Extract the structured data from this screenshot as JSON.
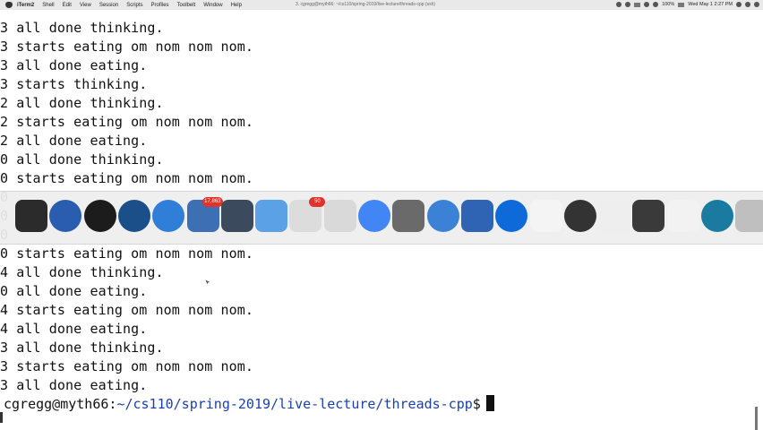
{
  "menubar": {
    "app_name": "iTerm2",
    "items": [
      "Shell",
      "Edit",
      "View",
      "Session",
      "Scripts",
      "Profiles",
      "Toolbelt",
      "Window",
      "Help"
    ],
    "window_title": "3. cgregg@myth66: ~/cs110/spring-2019/live-lecture/threads-cpp (ssh)",
    "status": {
      "battery": "100%",
      "datetime": "Wed May 1  2:27 PM"
    }
  },
  "terminal": {
    "lines": [
      "3 all done thinking.",
      "3 starts eating om nom nom nom.",
      "3 all done eating.",
      "3 starts thinking.",
      "2 all done thinking.",
      "2 starts eating om nom nom nom.",
      "2 all done eating.",
      "0 all done thinking.",
      "0 starts eating om nom nom nom.",
      "0",
      "0",
      "0",
      "0 starts eating om nom nom nom.",
      "4 all done thinking.",
      "0 all done eating.",
      "4 starts eating om nom nom nom.",
      "4 all done eating.",
      "3 all done thinking.",
      "3 starts eating om nom nom nom.",
      "3 all done eating."
    ],
    "prompt": {
      "user_host": "cgregg@myth66",
      "separator": ":",
      "path": "~/cs110/spring-2019/live-lecture/threads-cpp",
      "symbol": "$"
    }
  },
  "dock": {
    "apps": [
      {
        "icon": "terminal-icon",
        "color": "#2b2b2b"
      },
      {
        "icon": "firefox-icon",
        "color": "#2a5db0"
      },
      {
        "icon": "dvd-player-icon",
        "color": "#1c1c1c"
      },
      {
        "icon": "quicktime-icon",
        "color": "#1b4f8a"
      },
      {
        "icon": "safari-icon",
        "color": "#2f7fd8"
      },
      {
        "icon": "preview-icon",
        "color": "#3d6fb5",
        "badge": "17,863"
      },
      {
        "icon": "slack-icon",
        "color": "#3b4a5c"
      },
      {
        "icon": "finder-icon",
        "color": "#5aa1e6"
      },
      {
        "icon": "notes-icon",
        "color": "#dcdcdc",
        "badge": "50"
      },
      {
        "icon": "bbedit-icon",
        "color": "#d9d9d9"
      },
      {
        "icon": "chrome-icon",
        "color": "#4285f4"
      },
      {
        "icon": "keychain-icon",
        "color": "#6a6a6a"
      },
      {
        "icon": "messages-icon",
        "color": "#3b82d6"
      },
      {
        "icon": "image-capture-icon",
        "color": "#2f64b4"
      },
      {
        "icon": "teamviewer-icon",
        "color": "#0e6ad9"
      },
      {
        "icon": "calendar-icon",
        "color": "#f4f4f4"
      },
      {
        "icon": "activity-monitor-icon",
        "color": "#333333"
      },
      {
        "icon": "textedit-icon",
        "color": "#eeeeee"
      },
      {
        "icon": "notebook-icon",
        "color": "#3a3a3a"
      },
      {
        "icon": "document-icon",
        "color": "#f2f2f2"
      },
      {
        "icon": "arduino-icon",
        "color": "#1a7aa0"
      },
      {
        "icon": "trash-icon",
        "color": "#bfbfbf"
      }
    ]
  }
}
